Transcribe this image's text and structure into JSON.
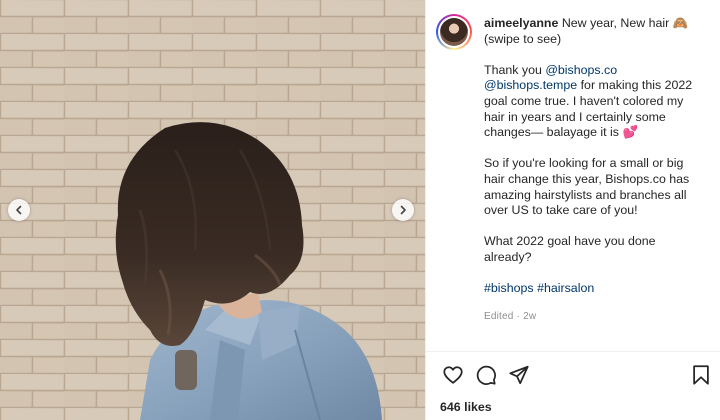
{
  "post": {
    "username": "aimeelyanne",
    "caption_lines": [
      "New year, New hair 🙈",
      "(swipe to see)"
    ],
    "body": {
      "thanks_prefix": "Thank you ",
      "mention_1": "@bishops.co",
      "mention_2": "@bishops.tempe",
      "thanks_rest_1": " for making this 2022",
      "thanks_rest_2": "goal come true. I haven't colored my",
      "thanks_rest_3": "hair in years and I certainly some",
      "thanks_rest_4": "changes— balayage it is 💕",
      "para2_1": "So if you're looking for a small or big",
      "para2_2": "hair change this year, Bishops.co has",
      "para2_3": "amazing hairstylists and branches all",
      "para2_4": "over US to take care of you!",
      "para3_1": "What 2022 goal have you done",
      "para3_2": "already?",
      "hashtag_1": "#bishops",
      "hashtag_2": "#hairsalon"
    },
    "meta": {
      "edited": "Edited",
      "separator": " · ",
      "age": "2w"
    },
    "likes": {
      "count": "646",
      "label": " likes"
    }
  },
  "icons": {
    "prev": "chevron-left-icon",
    "next": "chevron-right-icon",
    "like": "heart-icon",
    "comment": "comment-bubble-icon",
    "share": "paper-plane-icon",
    "save": "bookmark-icon"
  }
}
